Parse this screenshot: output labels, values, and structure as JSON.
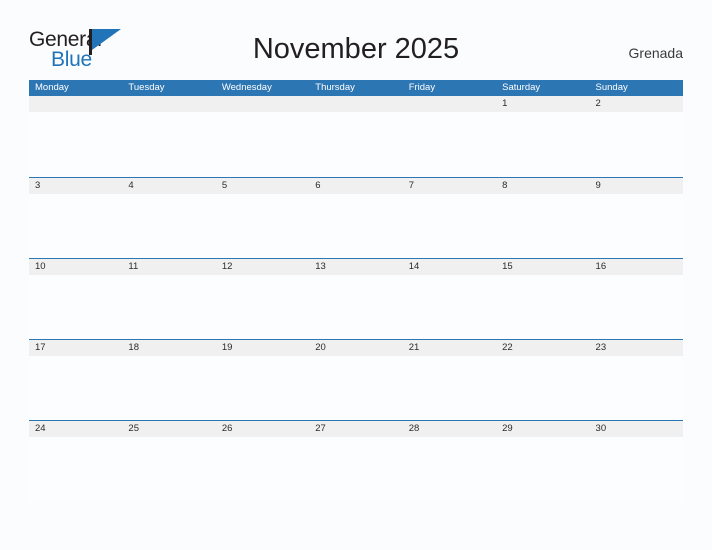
{
  "brand": {
    "name_part1": "General",
    "name_part2": "Blue",
    "flag_icon": "flag-triangle-icon",
    "color_dark": "#231f20",
    "color_blue": "#2274b8"
  },
  "header": {
    "title": "November 2025",
    "region": "Grenada"
  },
  "colors": {
    "header_blue": "#2d76b4",
    "day_band_gray": "#f0f0f0",
    "page_background": "#fbfcfd",
    "text_dark": "#231f20"
  },
  "calendar": {
    "month": "November",
    "year": "2025",
    "weekday_headers": [
      "Monday",
      "Tuesday",
      "Wednesday",
      "Thursday",
      "Friday",
      "Saturday",
      "Sunday"
    ],
    "weeks": [
      [
        "",
        "",
        "",
        "",
        "",
        "1",
        "2"
      ],
      [
        "3",
        "4",
        "5",
        "6",
        "7",
        "8",
        "9"
      ],
      [
        "10",
        "11",
        "12",
        "13",
        "14",
        "15",
        "16"
      ],
      [
        "17",
        "18",
        "19",
        "20",
        "21",
        "22",
        "23"
      ],
      [
        "24",
        "25",
        "26",
        "27",
        "28",
        "29",
        "30"
      ]
    ]
  }
}
